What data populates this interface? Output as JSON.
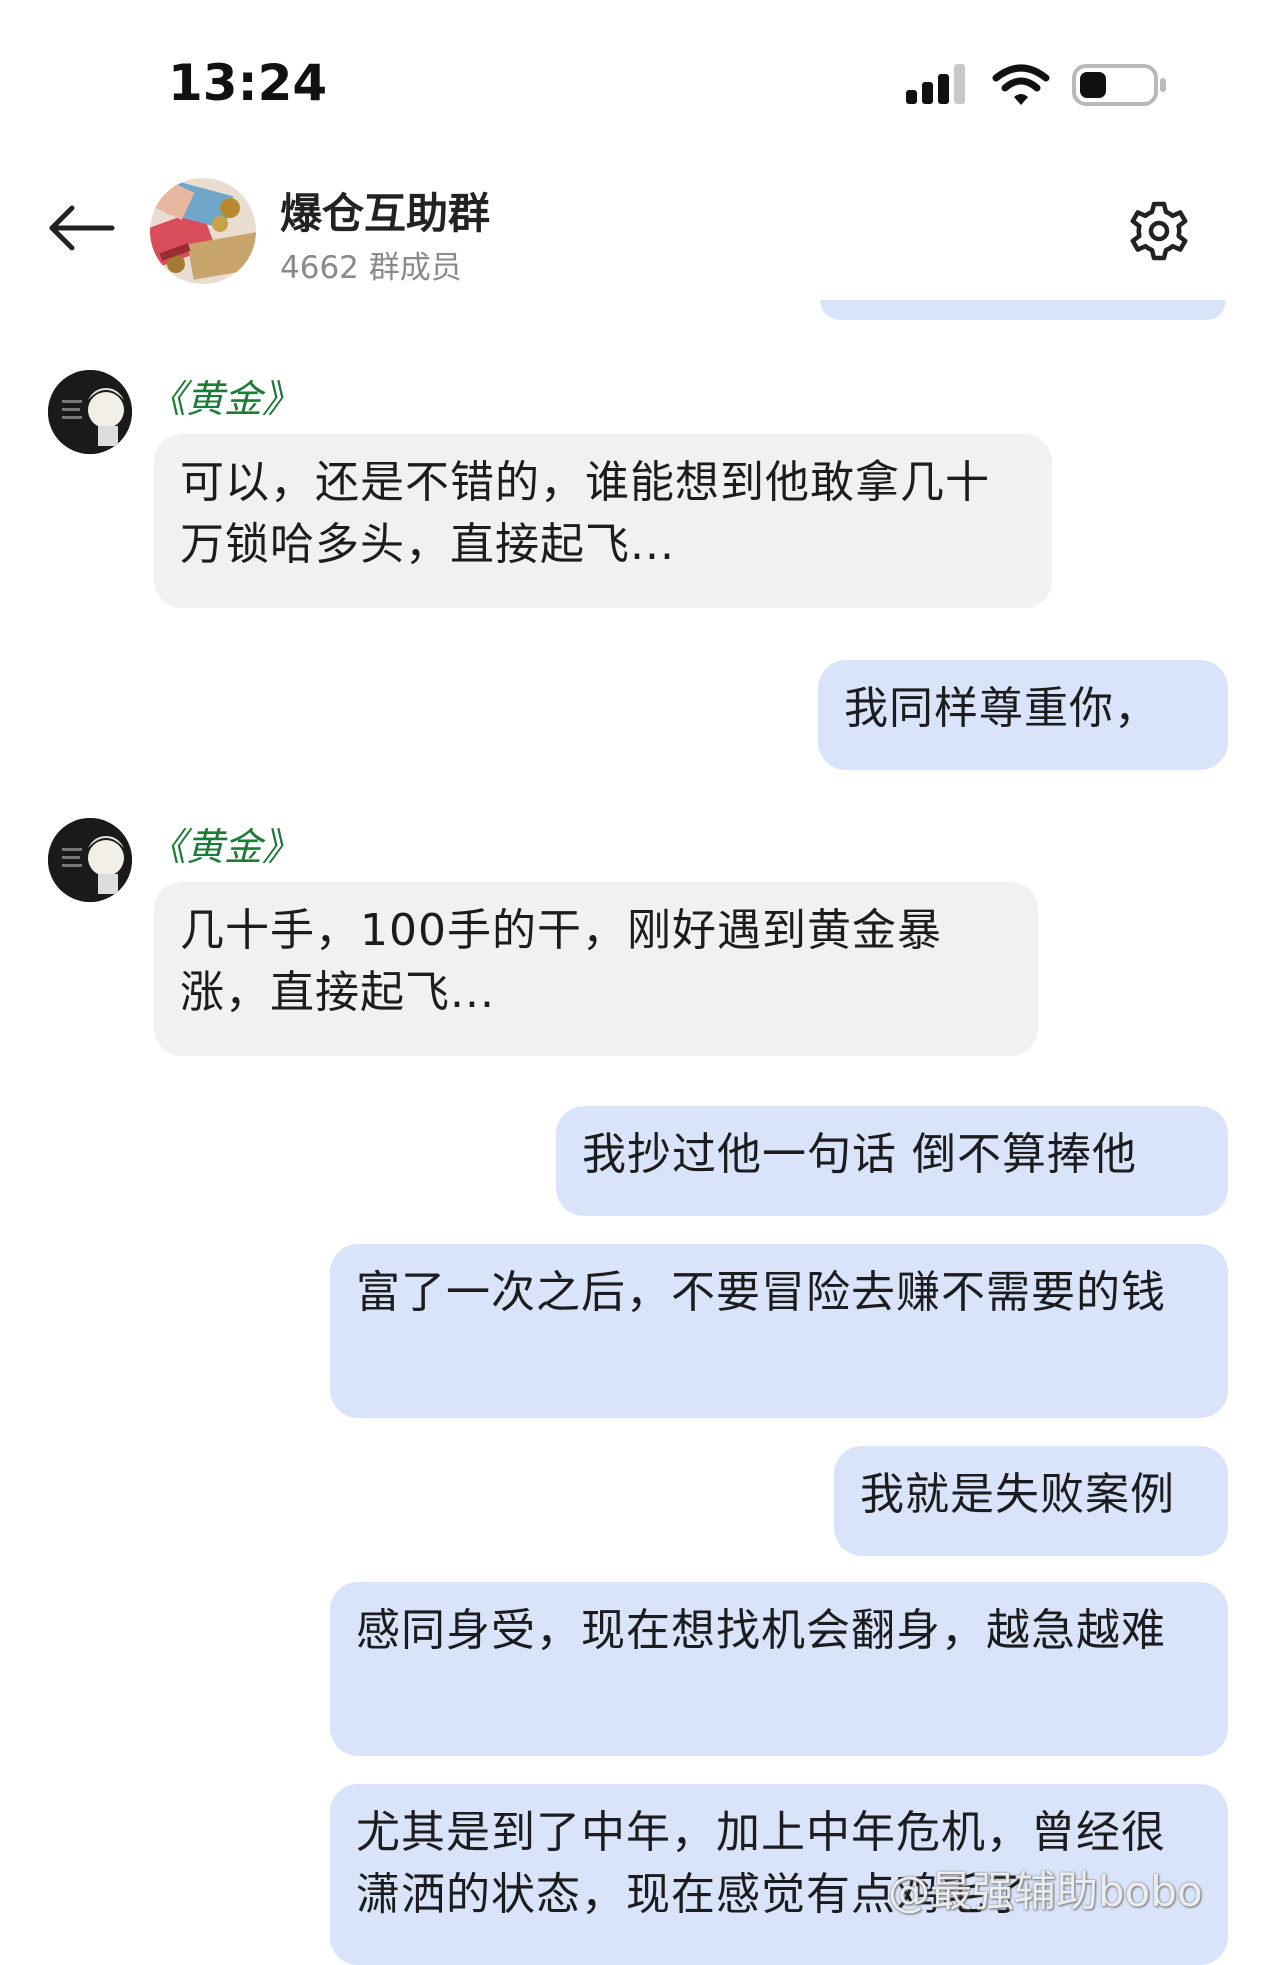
{
  "status_bar": {
    "time": "13:24"
  },
  "header": {
    "group_name": "爆仓互助群",
    "member_count": "4662 群成员"
  },
  "messages": [
    {
      "direction": "in",
      "sender": "《黄金》",
      "text": "可以，还是不错的，谁能想到他敢拿几十万锁哈多头，直接起飞..."
    },
    {
      "direction": "out",
      "text": "我同样尊重你，"
    },
    {
      "direction": "in",
      "sender": "《黄金》",
      "text": "几十手，100手的干，刚好遇到黄金暴涨，直接起飞..."
    },
    {
      "direction": "out",
      "text": "我抄过他一句话  倒不算捧他"
    },
    {
      "direction": "out",
      "text": "富了一次之后，不要冒险去赚不需要的钱"
    },
    {
      "direction": "out",
      "text": "我就是失败案例"
    },
    {
      "direction": "out",
      "text": "感同身受，现在想找机会翻身，越急越难"
    },
    {
      "direction": "out",
      "text": "尤其是到了中年，加上中年危机，曾经很潇洒的状态，现在感觉有点鸡毛了"
    }
  ],
  "watermark": "@最强辅助bobo",
  "colors": {
    "incoming_bubble": "#f1f1f3",
    "outgoing_bubble": "#d9e4fa",
    "sender_name": "#1d7a38",
    "subtitle": "#8a8a8e"
  },
  "icons": {
    "back": "arrow-left-icon",
    "settings": "gear-icon",
    "signal": "cellular-signal-icon",
    "wifi": "wifi-icon",
    "battery": "battery-icon"
  }
}
